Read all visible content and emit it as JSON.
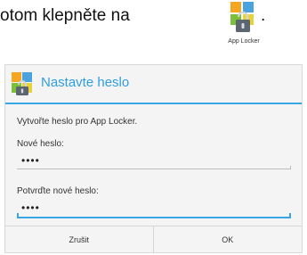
{
  "instruction": {
    "text": "otom klepněte na",
    "period": "."
  },
  "app_icon": {
    "name": "app-locker-icon",
    "caption": "App Locker"
  },
  "dialog": {
    "title": "Nastavte heslo",
    "message": "Vytvořte heslo pro App Locker.",
    "new_password_label": "Nové heslo:",
    "new_password_value": "••••",
    "confirm_password_label": "Potvrďte nové heslo:",
    "confirm_password_value": "••••",
    "cancel_label": "Zrušit",
    "ok_label": "OK"
  },
  "colors": {
    "accent": "#37a7e4",
    "title_text": "#2f9ee0",
    "dialog_bg": "#f4f4f4",
    "divider": "#d6d6d6"
  }
}
